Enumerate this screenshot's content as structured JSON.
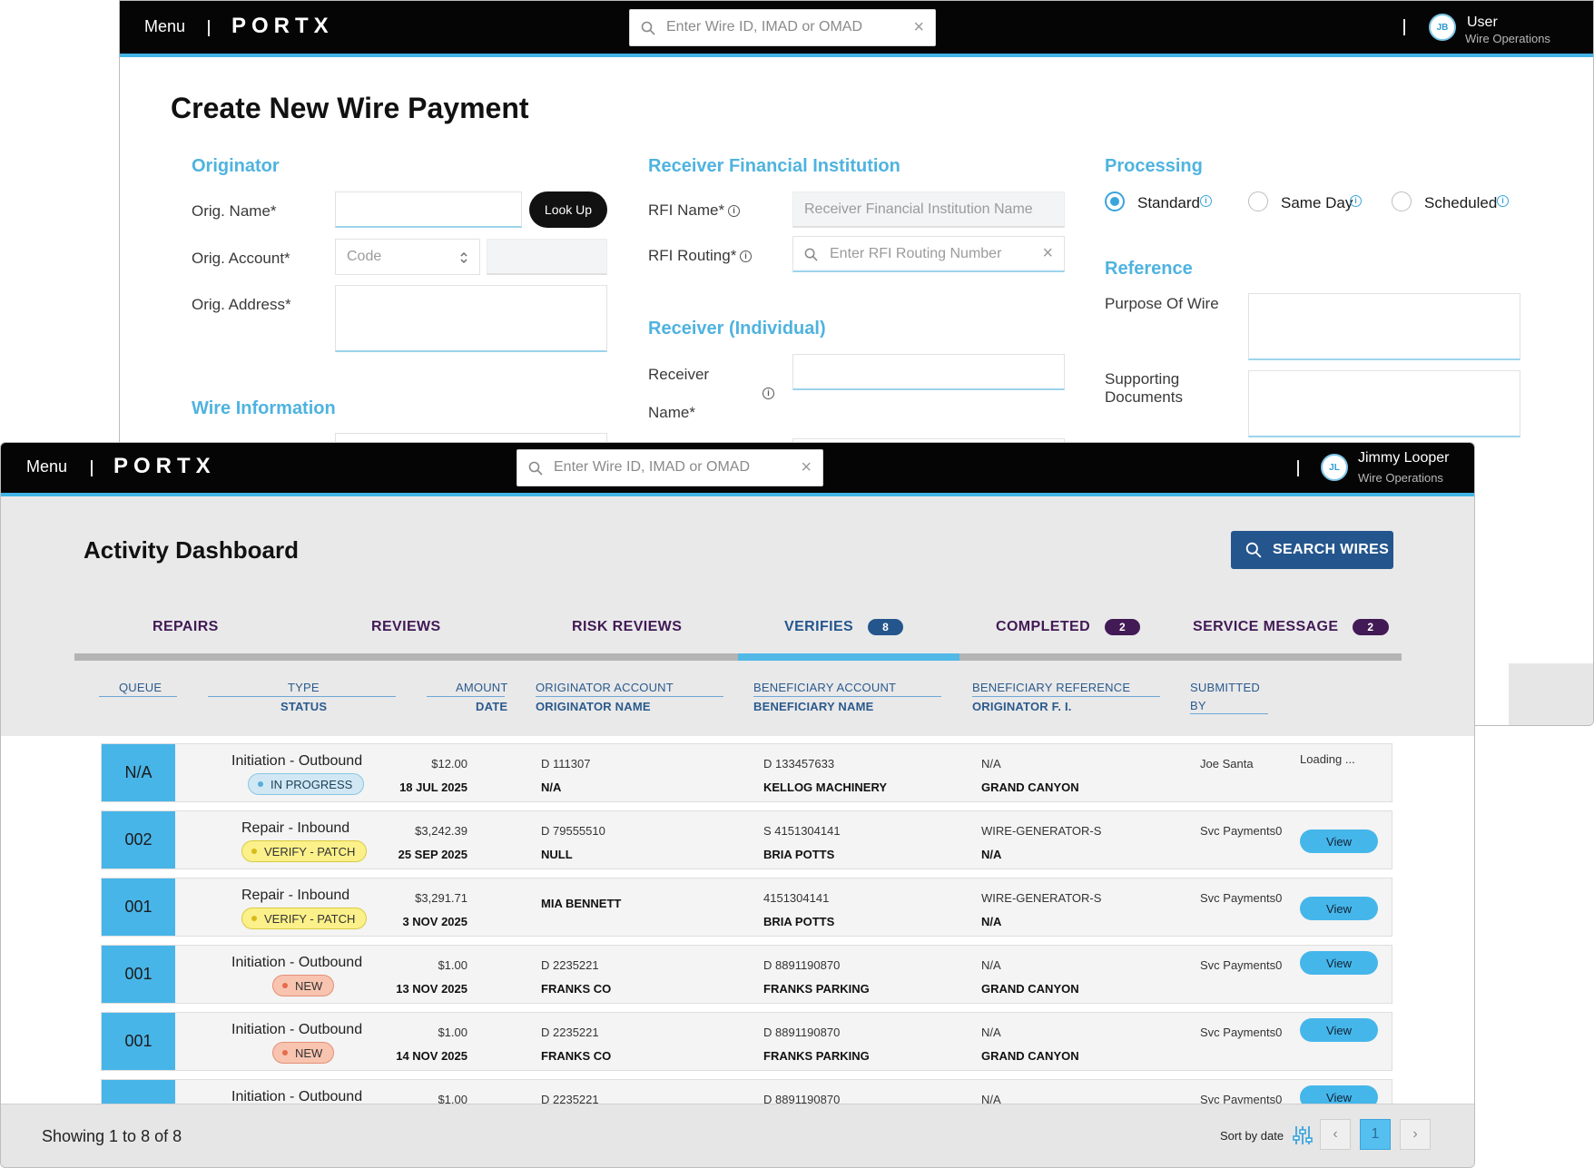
{
  "back_window": {
    "menu_label": "Menu",
    "logo_text": "PORTX",
    "search_placeholder": "Enter Wire ID, IMAD or OMAD",
    "user": {
      "initials": "JB",
      "name": "User",
      "role": "Wire Operations"
    },
    "title": "Create New Wire Payment",
    "originator": {
      "heading": "Originator",
      "name_label": "Orig. Name*",
      "lookup_label": "Look Up",
      "account_label": "Orig. Account*",
      "code_placeholder": "Code",
      "address_label": "Orig. Address*"
    },
    "wire_information_heading": "Wire Information",
    "rfi": {
      "heading": "Receiver Financial Institution",
      "name_label": "RFI Name*",
      "name_placeholder": "Receiver Financial Institution Name",
      "routing_label": "RFI Routing*",
      "routing_placeholder": "Enter RFI Routing Number"
    },
    "receiver": {
      "heading": "Receiver (Individual)",
      "name_label_line1": "Receiver",
      "name_label_line2": "Name*"
    },
    "processing": {
      "heading": "Processing",
      "options": [
        "Standard",
        "Same Day",
        "Scheduled"
      ],
      "selected": "Standard"
    },
    "reference": {
      "heading": "Reference",
      "purpose_label": "Purpose Of Wire",
      "docs_label_line1": "Supporting",
      "docs_label_line2": "Documents"
    }
  },
  "front_window": {
    "menu_label": "Menu",
    "logo_text": "PORTX",
    "search_placeholder": "Enter Wire ID, IMAD or OMAD",
    "user": {
      "initials": "JL",
      "name": "Jimmy Looper",
      "role": "Wire Operations"
    },
    "title": "Activity Dashboard",
    "search_wires_label": "SEARCH WIRES",
    "tabs": [
      {
        "label": "REPAIRS",
        "count": ""
      },
      {
        "label": "REVIEWS",
        "count": ""
      },
      {
        "label": "RISK REVIEWS",
        "count": ""
      },
      {
        "label": "VERIFIES",
        "count": "8"
      },
      {
        "label": "COMPLETED",
        "count": "2"
      },
      {
        "label": "SERVICE MESSAGE",
        "count": "2"
      }
    ],
    "active_tab": "VERIFIES",
    "columns": {
      "queue": "QUEUE",
      "type": "TYPE",
      "status": "STATUS",
      "amount": "AMOUNT",
      "date": "DATE",
      "orig_account": "ORIGINATOR ACCOUNT",
      "orig_name": "ORIGINATOR NAME",
      "benef_account": "BENEFICIARY ACCOUNT",
      "benef_name": "BENEFICIARY NAME",
      "benef_reference": "BENEFICIARY REFERENCE",
      "orig_fi": "ORIGINATOR F. I.",
      "submitted": "SUBMITTED",
      "by": "BY"
    },
    "rows": [
      {
        "queue": "N/A",
        "type": "Initiation  -  Outbound",
        "status": "IN PROGRESS",
        "status_kind": "prog",
        "amount": "$12.00",
        "date": "18 JUL 2025",
        "orig_account": "D 111307",
        "orig_name": "N/A",
        "benef_account": "D 133457633",
        "benef_name": "KELLOG MACHINERY",
        "benef_ref": "N/A",
        "orig_fi": "GRAND CANYON",
        "submitted_by": "Joe Santa",
        "action": "Loading ..."
      },
      {
        "queue": "002",
        "type": "Repair  -  Inbound",
        "status": "VERIFY - PATCH",
        "status_kind": "verify",
        "amount": "$3,242.39",
        "date": "25 SEP 2025",
        "orig_account": "D 79555510",
        "orig_name": "NULL",
        "benef_account": "S 4151304141",
        "benef_name": "BRIA POTTS",
        "benef_ref": "WIRE-GENERATOR-S",
        "orig_fi": "N/A",
        "submitted_by": "Svc Payments0",
        "action": "View"
      },
      {
        "queue": "001",
        "type": "Repair  -  Inbound",
        "status": "VERIFY - PATCH",
        "status_kind": "verify",
        "amount": "$3,291.71",
        "date": "3 NOV 2025",
        "orig_account": "",
        "orig_name": "MIA BENNETT",
        "benef_account": "4151304141",
        "benef_name": "BRIA POTTS",
        "benef_ref": "WIRE-GENERATOR-S",
        "orig_fi": "N/A",
        "submitted_by": "Svc Payments0",
        "action": "View"
      },
      {
        "queue": "001",
        "type": "Initiation  -  Outbound",
        "status": "NEW",
        "status_kind": "new",
        "amount": "$1.00",
        "date": "13 NOV 2025",
        "orig_account": "D 2235221",
        "orig_name": "FRANKS CO",
        "benef_account": "D 8891190870",
        "benef_name": "FRANKS PARKING",
        "benef_ref": "N/A",
        "orig_fi": "GRAND CANYON",
        "submitted_by": "Svc Payments0",
        "action": "View"
      },
      {
        "queue": "001",
        "type": "Initiation  -  Outbound",
        "status": "NEW",
        "status_kind": "new",
        "amount": "$1.00",
        "date": "14 NOV 2025",
        "orig_account": "D 2235221",
        "orig_name": "FRANKS CO",
        "benef_account": "D 8891190870",
        "benef_name": "FRANKS PARKING",
        "benef_ref": "N/A",
        "orig_fi": "GRAND CANYON",
        "submitted_by": "Svc Payments0",
        "action": "View"
      },
      {
        "queue": "",
        "type": "Initiation  -  Outbound",
        "status": "",
        "status_kind": "",
        "amount": "$1.00",
        "date": "",
        "orig_account": "D 2235221",
        "orig_name": "",
        "benef_account": "D 8891190870",
        "benef_name": "",
        "benef_ref": "N/A",
        "orig_fi": "",
        "submitted_by": "Svc Payments0",
        "action": "View"
      }
    ],
    "footer": {
      "showing": "Showing 1 to 8 of 8",
      "sort_label": "Sort by date",
      "current_page": "1",
      "prev": "‹",
      "next": "›"
    }
  }
}
